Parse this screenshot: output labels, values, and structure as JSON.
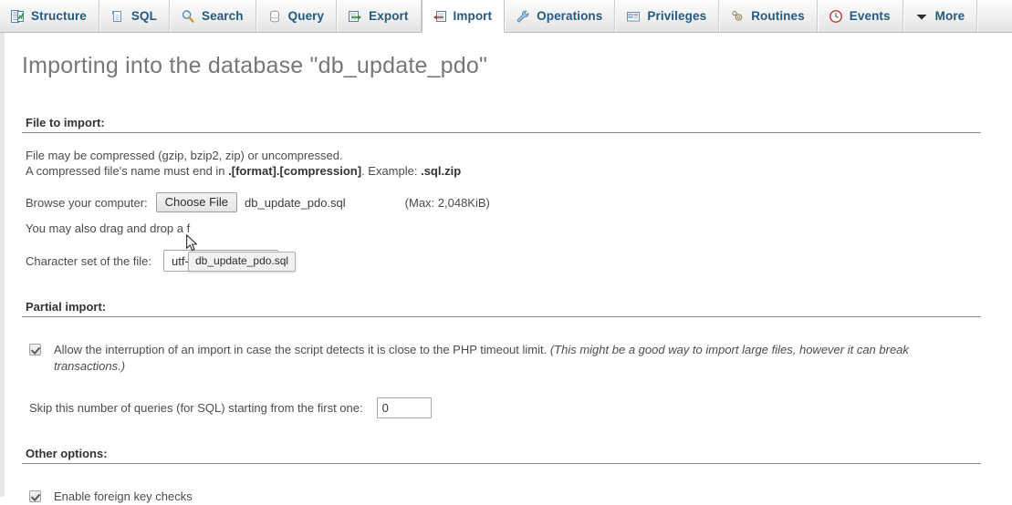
{
  "tabs": [
    {
      "label": "Structure",
      "icon": "structure-icon",
      "active": false
    },
    {
      "label": "SQL",
      "icon": "sql-icon",
      "active": false
    },
    {
      "label": "Search",
      "icon": "search-icon",
      "active": false
    },
    {
      "label": "Query",
      "icon": "query-icon",
      "active": false
    },
    {
      "label": "Export",
      "icon": "export-icon",
      "active": false
    },
    {
      "label": "Import",
      "icon": "import-icon",
      "active": true
    },
    {
      "label": "Operations",
      "icon": "wrench-icon",
      "active": false
    },
    {
      "label": "Privileges",
      "icon": "privileges-icon",
      "active": false
    },
    {
      "label": "Routines",
      "icon": "routines-icon",
      "active": false
    },
    {
      "label": "Events",
      "icon": "clock-icon",
      "active": false
    },
    {
      "label": "More",
      "icon": "chevron-down-icon",
      "active": false
    }
  ],
  "page": {
    "title": "Importing into the database \"db_update_pdo\""
  },
  "file_section": {
    "heading": "File to import:",
    "note_line1": "File may be compressed (gzip, bzip2, zip) or uncompressed.",
    "note_line2_prefix": "A compressed file's name must end in ",
    "note_line2_bold1": ".[format].[compression]",
    "note_line2_middle": ". Example: ",
    "note_line2_bold2": ".sql.zip",
    "browse_label": "Browse your computer:",
    "choose_file_button": "Choose File",
    "selected_file": "db_update_pdo.sql",
    "max_size": "(Max: 2,048KiB)",
    "dragdrop_label": "You may also drag and drop a f",
    "charset_label": "Character set of the file:",
    "charset_value": "utf-8",
    "tooltip": "db_update_pdo.sql"
  },
  "partial_section": {
    "heading": "Partial import:",
    "interrupt_label_plain": "Allow the interruption of an import in case the script detects it is close to the PHP timeout limit. ",
    "interrupt_label_italic": "(This might be a good way to import large files, however it can break transactions.)",
    "interrupt_checked": true,
    "skip_label": "Skip this number of queries (for SQL) starting from the first one:",
    "skip_value": "0"
  },
  "other_section": {
    "heading": "Other options:",
    "fk_label": "Enable foreign key checks",
    "fk_checked": true
  },
  "colors": {
    "tab_text": "#235a81",
    "title_text": "#777777",
    "body_text": "#4c4c4c",
    "heading_text": "#333333"
  }
}
